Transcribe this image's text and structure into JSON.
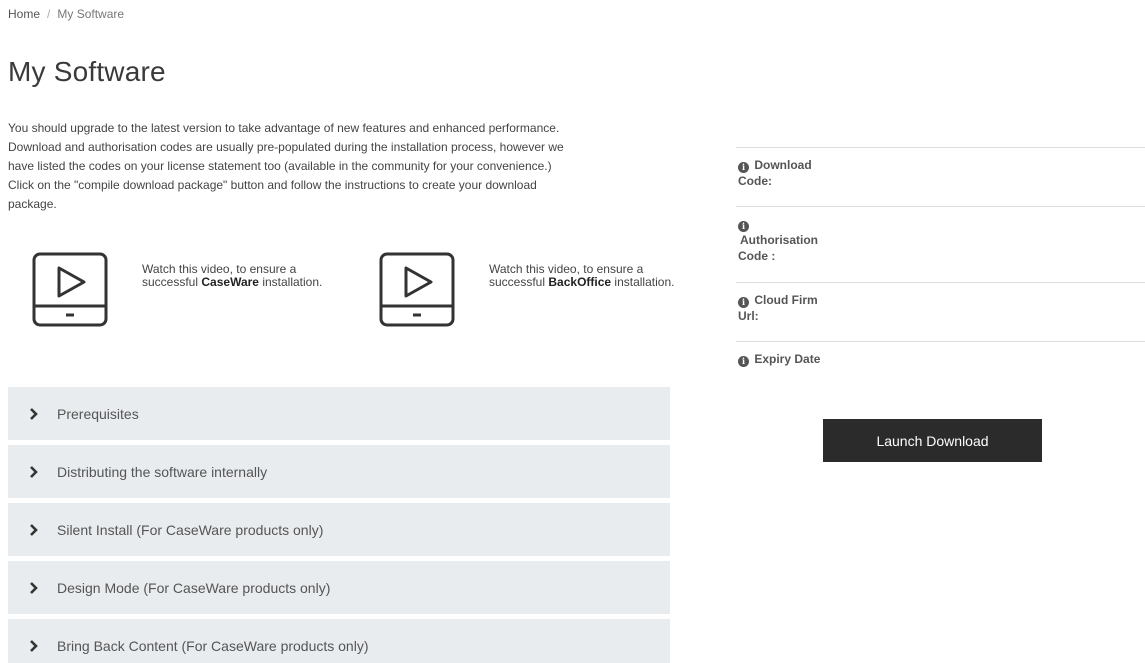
{
  "breadcrumb": {
    "home": "Home",
    "separator": "/",
    "current": "My Software"
  },
  "page_title": "My Software",
  "intro": {
    "line1": "You should upgrade to the latest version to take advantage of new features and enhanced performance.",
    "line2": "Download and authorisation codes are usually pre-populated during the installation process, however we",
    "line3": "have listed the codes on your license statement too (available in the community for your convenience.)",
    "line4": "Click on the \"compile download package\" button and follow the instructions to create your download",
    "line5": "package."
  },
  "videos": [
    {
      "icon": "video-play-icon",
      "prefix": "Watch this video, to ensure a successful",
      "product": "CaseWare",
      "suffix": "installation."
    },
    {
      "icon": "video-play-icon",
      "prefix": "Watch this video, to ensure a successful",
      "product": "BackOffice",
      "suffix": "installation."
    }
  ],
  "accordion": {
    "icon": "chevron-right-icon",
    "items": [
      {
        "label": "Prerequisites"
      },
      {
        "label": "Distributing the software internally"
      },
      {
        "label": "Silent Install (For CaseWare products only)"
      },
      {
        "label": "Design Mode (For CaseWare products only)"
      },
      {
        "label": "Bring Back Content (For CaseWare products only)"
      }
    ]
  },
  "info_panel": {
    "icon": "info-icon",
    "icon_glyph": "i",
    "download_code_label": "Download Code:",
    "authorisation_code_label": "Authorisation Code :",
    "cloud_firm_url_label": "Cloud Firm Url:",
    "expiry_date_label": "Expiry Date"
  },
  "launch_button": "Launch Download",
  "colors": {
    "accordion_bg": "#e9ecef",
    "button_bg": "#2b2b2b",
    "text": "#333333"
  }
}
